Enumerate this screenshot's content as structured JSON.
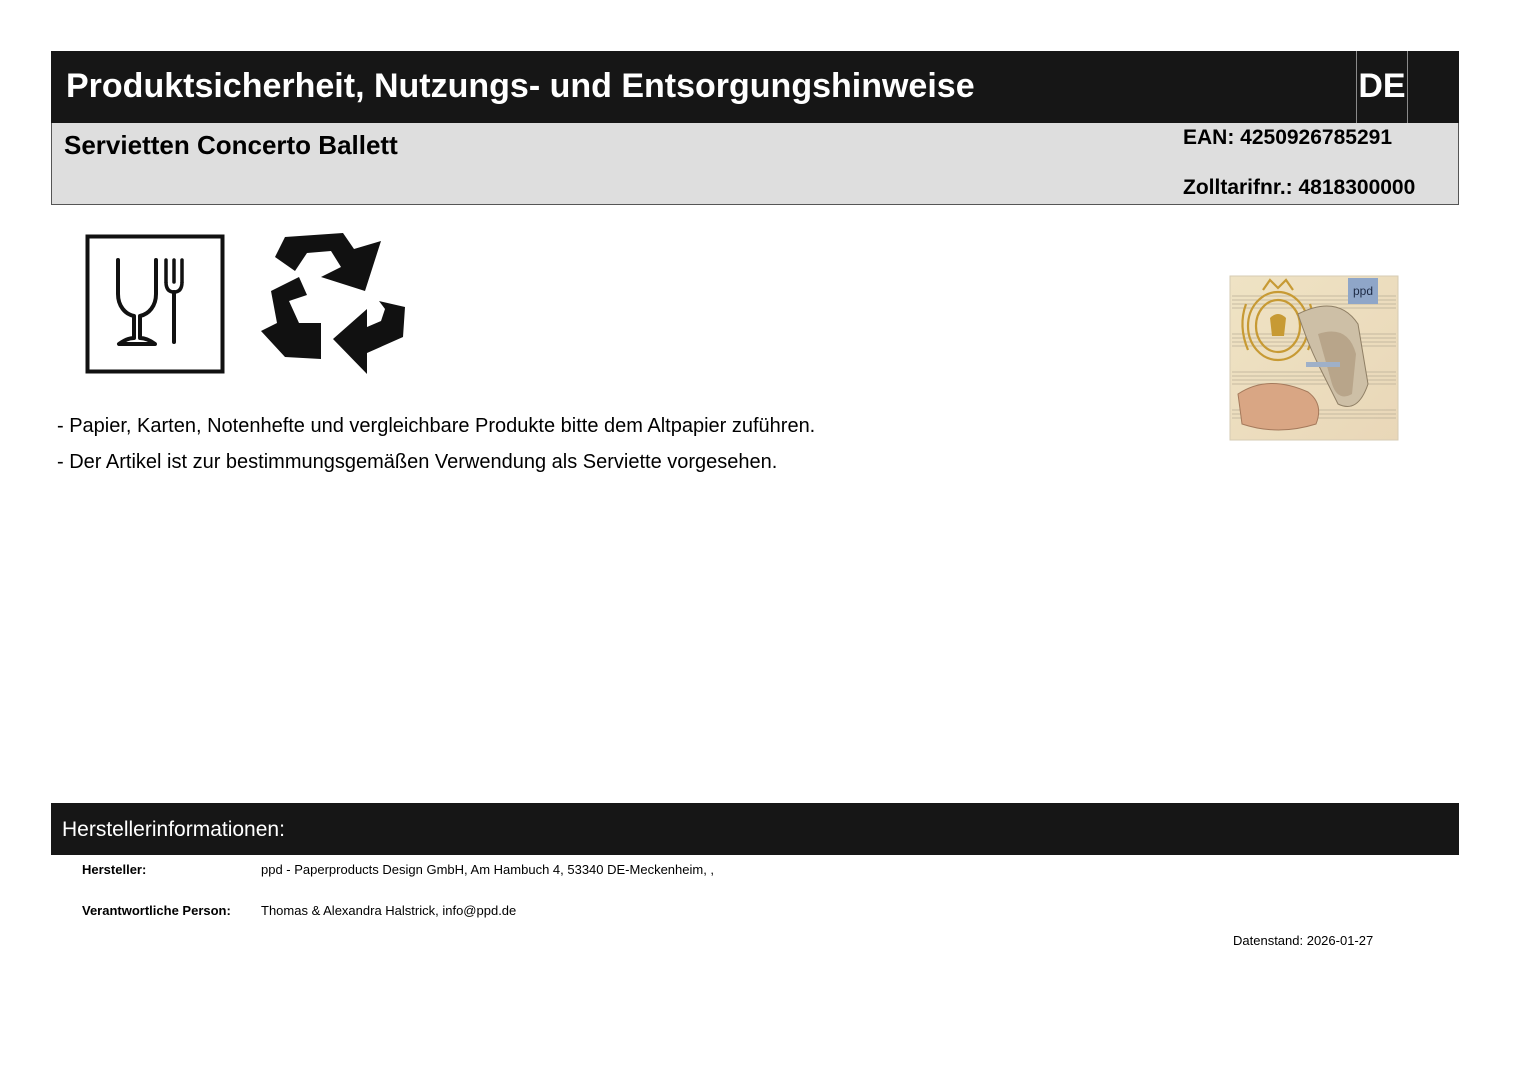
{
  "header": {
    "title": "Produktsicherheit, Nutzungs- und Entsorgungshinweise",
    "language": "DE"
  },
  "product": {
    "name": "Servietten Concerto Ballett",
    "ean": "EAN: 4250926785291",
    "tariff": "Zolltarifnr.: 4818300000",
    "image_logo": "ppd"
  },
  "icons": [
    "food-safe-icon",
    "recycle-icon"
  ],
  "notes": [
    "- Papier, Karten, Notenhefte und vergleichbare Produkte bitte dem Altpapier zuführen.",
    "- Der Artikel ist zur bestimmungsgemäßen Verwendung als Serviette vorgesehen."
  ],
  "manufacturer": {
    "section_title": "Herstellerinformationen:",
    "maker_label": "Hersteller:",
    "maker_value": "ppd - Paperproducts Design GmbH, Am Hambuch 4, 53340 DE-Meckenheim, ,",
    "person_label": "Verantwortliche Person:",
    "person_value": "Thomas & Alexandra Halstrick, info@ppd.de"
  },
  "date": "Datenstand: 2026-01-27"
}
